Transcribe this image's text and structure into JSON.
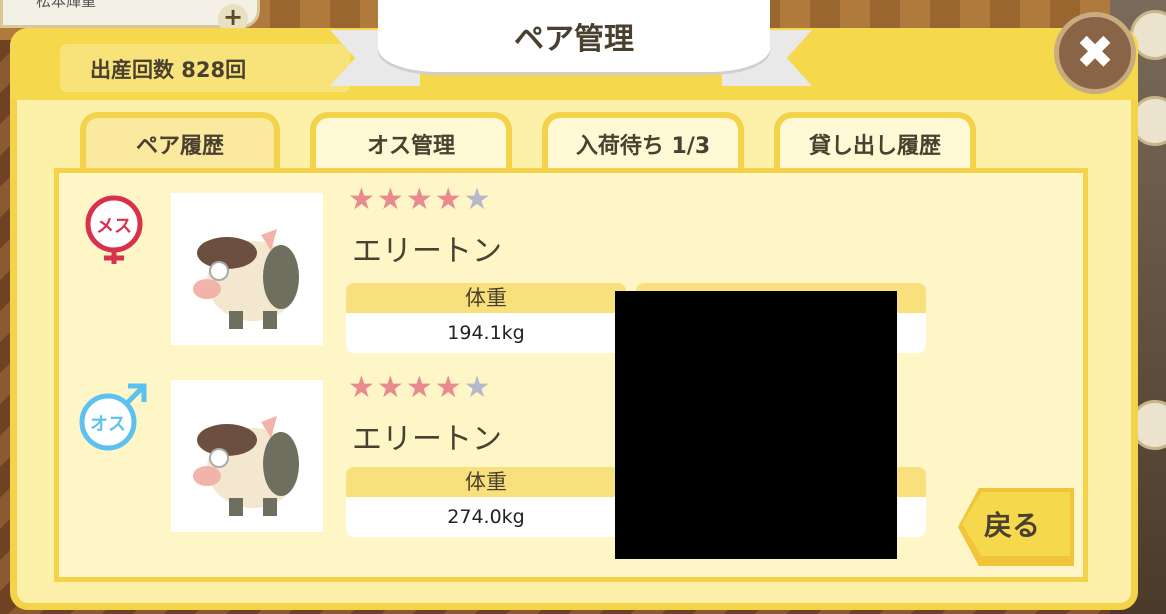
{
  "top_bar": {
    "player_name": "松本輝重",
    "plus_symbol": "+"
  },
  "header": {
    "title": "ペア管理",
    "birth_count_label": "出産回数 828回",
    "close_symbol": "✖"
  },
  "tabs": [
    {
      "label": "ペア履歴",
      "active": true
    },
    {
      "label": "オス管理",
      "active": false
    },
    {
      "label": "入荷待ち 1/3",
      "active": false
    },
    {
      "label": "貸し出し履歴",
      "active": false
    }
  ],
  "pairs": [
    {
      "sex_label": "メス",
      "sex_icon": "female-icon",
      "sex_color": "#d9304b",
      "rating": 4,
      "max_rating": 5,
      "name": "エリートン",
      "stat_label": "体重",
      "stat_value": "194.1kg"
    },
    {
      "sex_label": "オス",
      "sex_icon": "male-icon",
      "sex_color": "#5cc0f0",
      "rating": 4,
      "max_rating": 5,
      "name": "エリートン",
      "stat_label": "体重",
      "stat_value": "274.0kg"
    }
  ],
  "back_button": {
    "label": "戻る"
  },
  "colors": {
    "panel": "#fdf0a8",
    "border": "#f4d34a",
    "star_on": "#e88a8e",
    "star_off": "#b7b8c9"
  }
}
